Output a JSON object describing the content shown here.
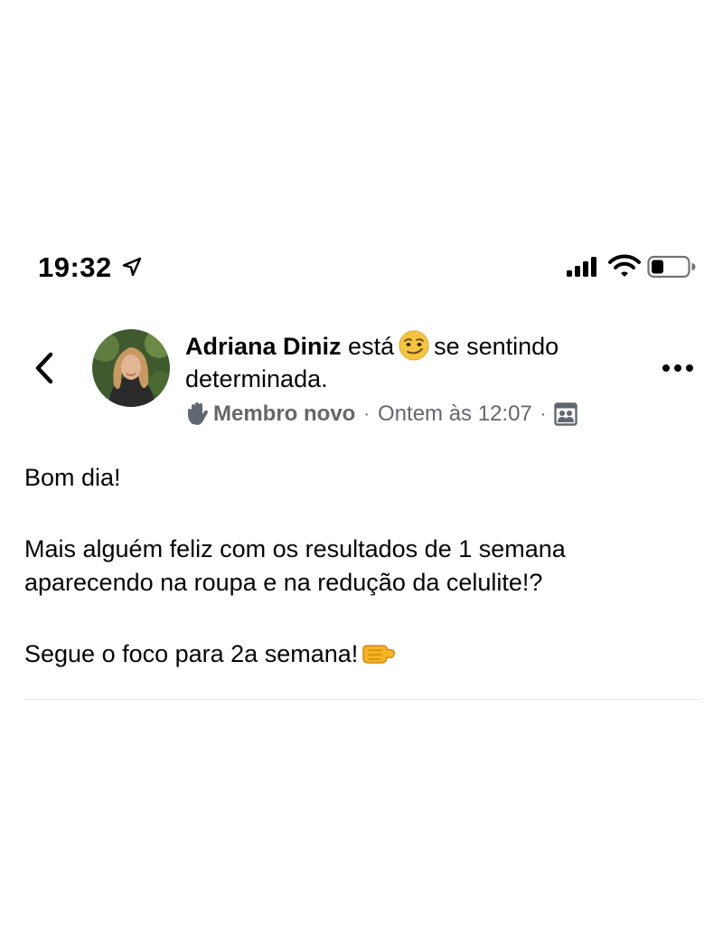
{
  "status_bar": {
    "time": "19:32",
    "icons": [
      "location-arrow-icon",
      "signal-icon",
      "wifi-icon",
      "battery-icon"
    ]
  },
  "post": {
    "author": "Adriana Diniz",
    "verb": "está",
    "feeling_emoji": "smirk-emoji-icon",
    "feeling_text": "se sentindo determinada.",
    "badge_icon": "wave-hand-icon",
    "badge_label": "Membro novo",
    "separator": "·",
    "timestamp": "Ontem às 12:07",
    "audience_icon": "group-members-icon",
    "body": {
      "line1": "Bom dia!",
      "line2": "Mais alguém feliz com os resultados de 1 semana aparecendo na roupa e na redução da celulite!?",
      "line3": "Segue o foco para 2a semana!",
      "line3_emoji": "fist-bump-emoji-icon"
    }
  },
  "colors": {
    "text": "#050505",
    "secondary": "#65676b",
    "divider": "#e4e6eb"
  }
}
